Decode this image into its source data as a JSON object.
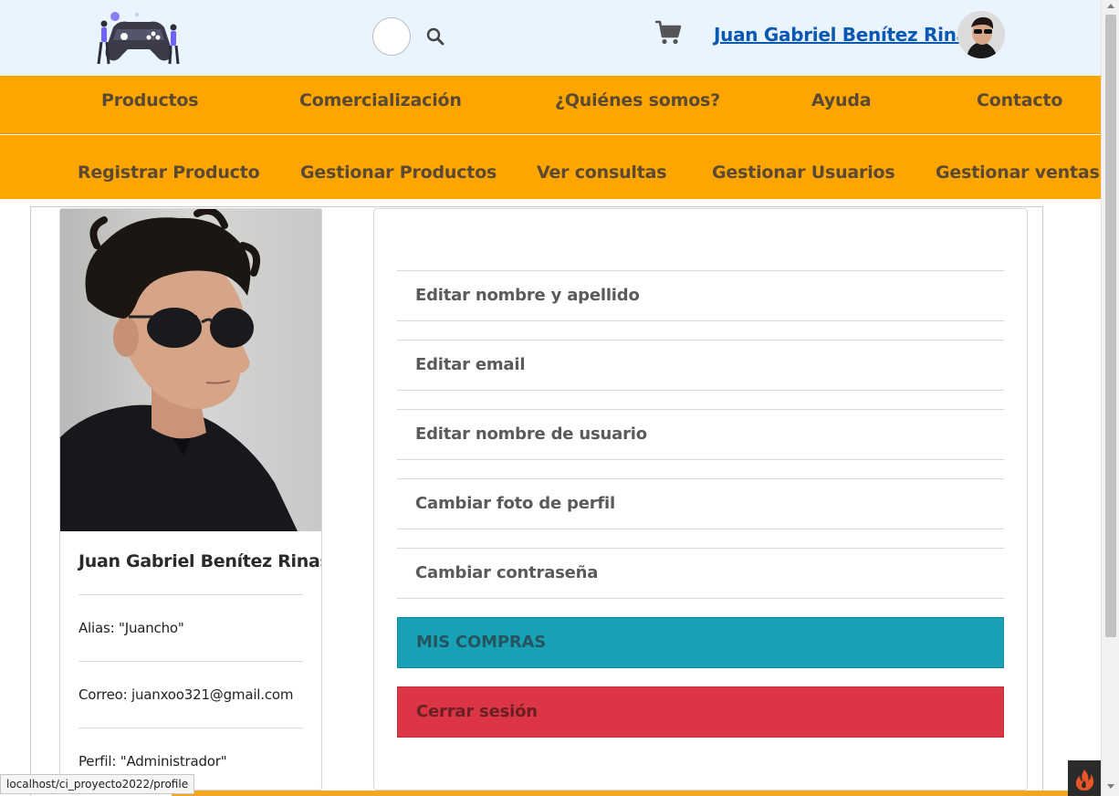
{
  "header": {
    "user_name": "Juan Gabriel Benítez Rinas",
    "icons": [
      "logo-gamers",
      "search-icon",
      "cart-icon",
      "avatar"
    ]
  },
  "nav_primary": [
    "Productos",
    "Comercialización",
    "¿Quiénes somos?",
    "Ayuda",
    "Contacto"
  ],
  "nav_admin": [
    "Registrar Producto",
    "Gestionar Productos",
    "Ver consultas",
    "Gestionar Usuarios",
    "Gestionar ventas"
  ],
  "profile": {
    "name": "Juan Gabriel Benítez Rinas",
    "alias": "Alias: \"Juancho\"",
    "email": "Correo: juanxoo321@gmail.com",
    "perfil": "Perfil: \"Administrador\""
  },
  "actions": [
    "Editar nombre y apellido",
    "Editar email",
    "Editar nombre de usuario",
    "Cambiar foto de perfil",
    "Cambiar contraseña"
  ],
  "buttons": {
    "compras": "MIS COMPRAS",
    "logout": "Cerrar sesión"
  },
  "status_url": "localhost/ci_proyecto2022/profile",
  "colors": {
    "header_bg": "#eaf4ff",
    "nav_bg": "#ffa500",
    "compras_bg": "#17a2b8",
    "logout_bg": "#dc3545",
    "link": "#0b58b3"
  }
}
